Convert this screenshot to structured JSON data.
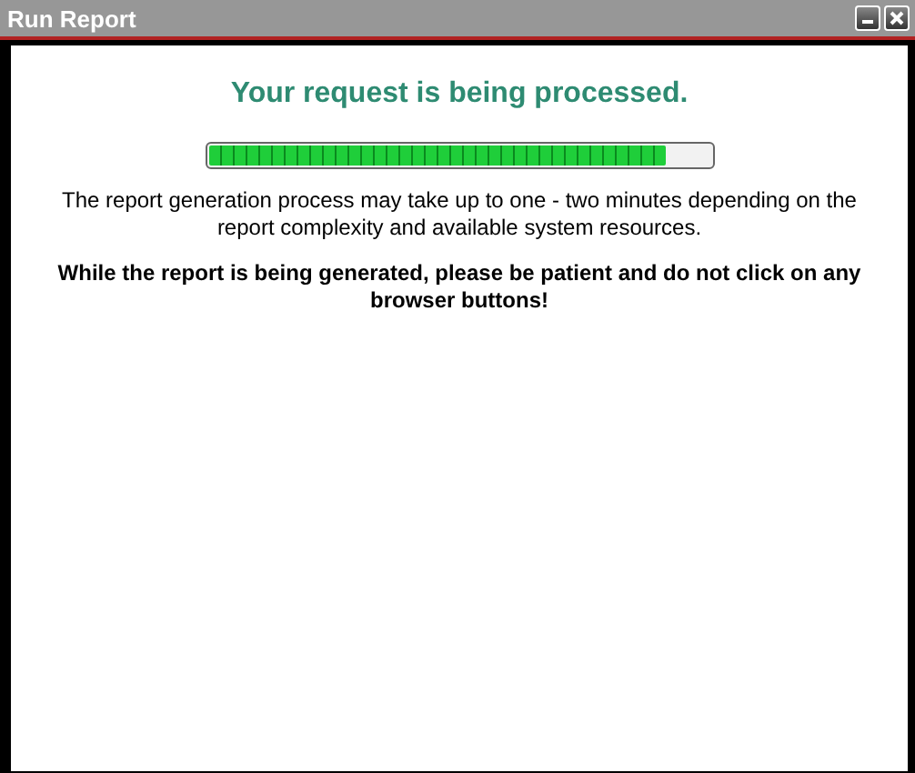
{
  "window": {
    "title": "Run Report"
  },
  "heading": "Your request is being processed.",
  "progress": {
    "level": 0.91
  },
  "message": "The report generation process may take up to one - two minutes depending on the report complexity and available system resources.",
  "warning": "While the report is being generated, please be patient and do not click on any browser buttons!"
}
